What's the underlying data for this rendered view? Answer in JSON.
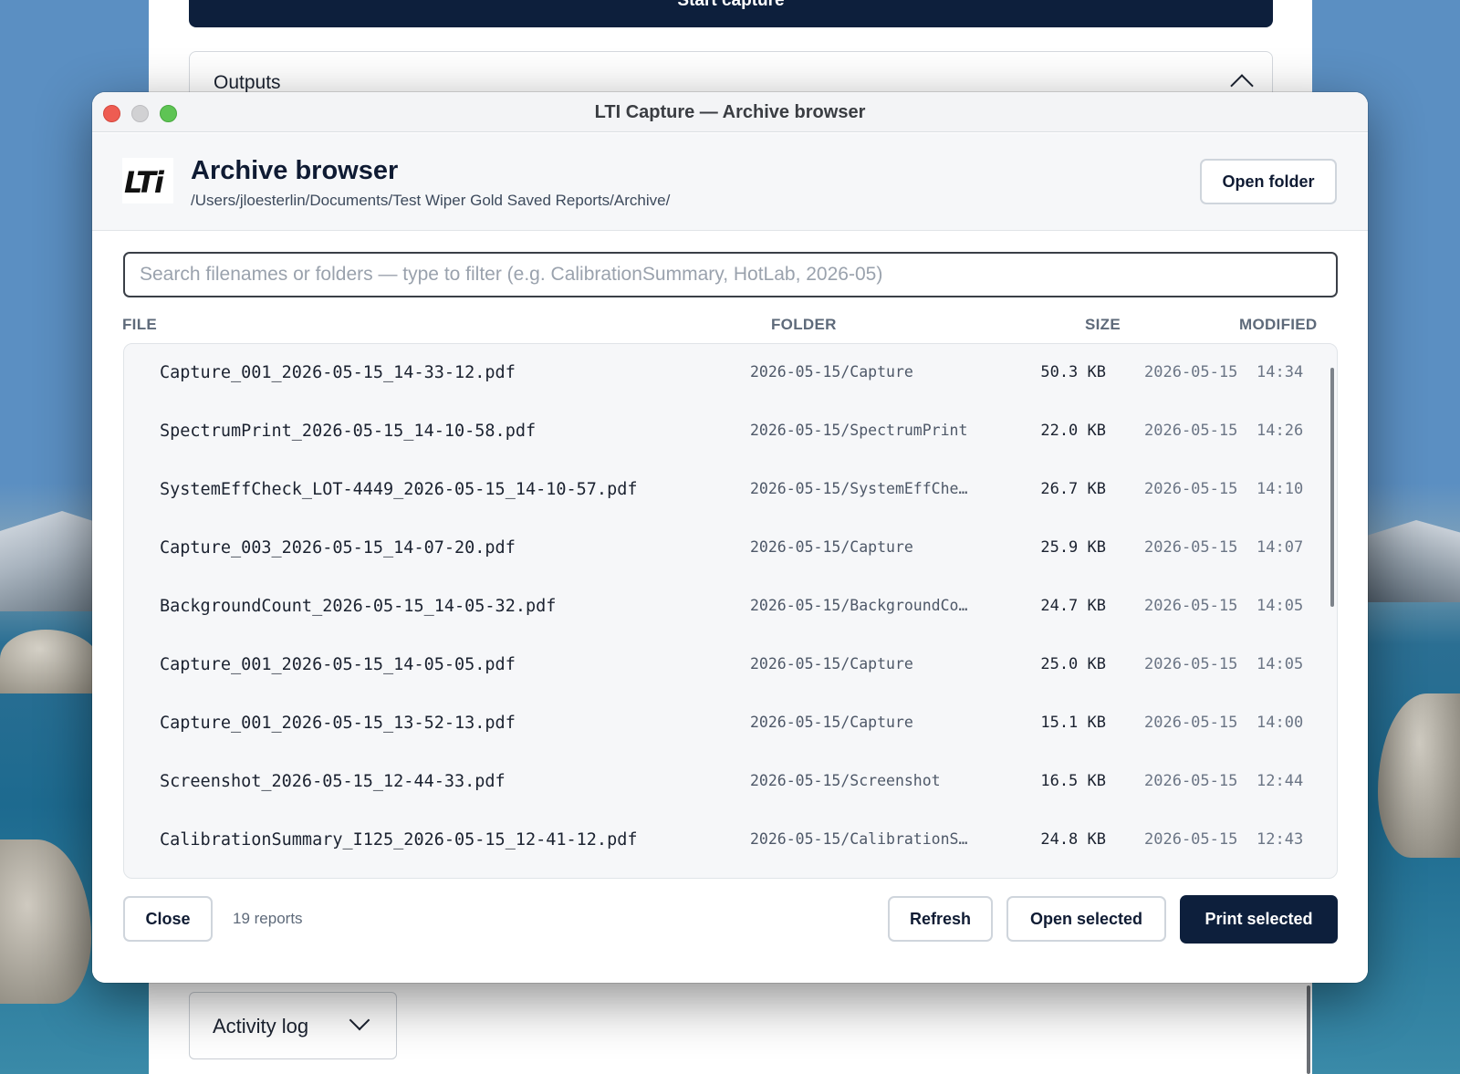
{
  "background_app": {
    "start_button_label": "Start capture",
    "outputs_label": "Outputs",
    "activity_log_label": "Activity log"
  },
  "window": {
    "title": "LTI Capture — Archive browser"
  },
  "header": {
    "logo_text": "LTi",
    "title": "Archive browser",
    "path": "/Users/jloesterlin/Documents/Test Wiper Gold Saved Reports/Archive/",
    "open_folder_label": "Open folder"
  },
  "search": {
    "placeholder": "Search filenames or folders — type to filter (e.g. CalibrationSummary, HotLab, 2026-05)",
    "value": ""
  },
  "columns": {
    "file": "FILE",
    "folder": "FOLDER",
    "size": "SIZE",
    "modified": "MODIFIED"
  },
  "rows": [
    {
      "file": "Capture_001_2026-05-15_14-33-12.pdf",
      "folder": "2026-05-15/Capture",
      "size": "50.3 KB",
      "date": "2026-05-15",
      "time": "14:34"
    },
    {
      "file": "SpectrumPrint_2026-05-15_14-10-58.pdf",
      "folder": "2026-05-15/SpectrumPrint",
      "size": "22.0 KB",
      "date": "2026-05-15",
      "time": "14:26"
    },
    {
      "file": "SystemEffCheck_LOT-4449_2026-05-15_14-10-57.pdf",
      "folder": "2026-05-15/SystemEffChe…",
      "size": "26.7 KB",
      "date": "2026-05-15",
      "time": "14:10"
    },
    {
      "file": "Capture_003_2026-05-15_14-07-20.pdf",
      "folder": "2026-05-15/Capture",
      "size": "25.9 KB",
      "date": "2026-05-15",
      "time": "14:07"
    },
    {
      "file": "BackgroundCount_2026-05-15_14-05-32.pdf",
      "folder": "2026-05-15/BackgroundCo…",
      "size": "24.7 KB",
      "date": "2026-05-15",
      "time": "14:05"
    },
    {
      "file": "Capture_001_2026-05-15_14-05-05.pdf",
      "folder": "2026-05-15/Capture",
      "size": "25.0 KB",
      "date": "2026-05-15",
      "time": "14:05"
    },
    {
      "file": "Capture_001_2026-05-15_13-52-13.pdf",
      "folder": "2026-05-15/Capture",
      "size": "15.1 KB",
      "date": "2026-05-15",
      "time": "14:00"
    },
    {
      "file": "Screenshot_2026-05-15_12-44-33.pdf",
      "folder": "2026-05-15/Screenshot",
      "size": "16.5 KB",
      "date": "2026-05-15",
      "time": "12:44"
    },
    {
      "file": "CalibrationSummary_I125_2026-05-15_12-41-12.pdf",
      "folder": "2026-05-15/CalibrationS…",
      "size": "24.8 KB",
      "date": "2026-05-15",
      "time": "12:43"
    }
  ],
  "footer": {
    "close_label": "Close",
    "report_count": "19 reports",
    "refresh_label": "Refresh",
    "open_selected_label": "Open selected",
    "print_selected_label": "Print selected"
  },
  "colors": {
    "primary_dark": "#0d1f3c",
    "close_light": "#ee5c52",
    "minimize_light": "#d1d1d3",
    "maximize_light": "#5ec454"
  }
}
